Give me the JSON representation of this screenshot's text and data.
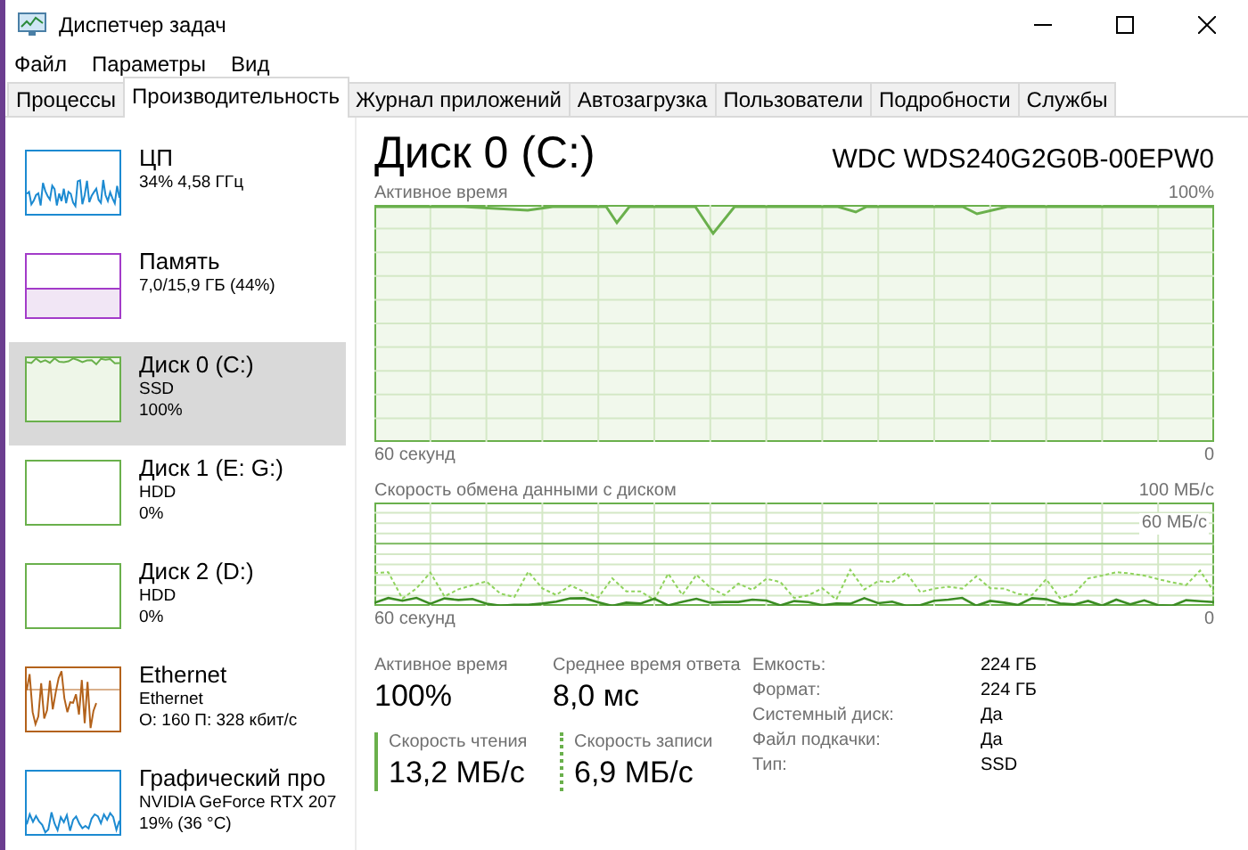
{
  "window": {
    "title": "Диспетчер задач"
  },
  "menu": [
    "Файл",
    "Параметры",
    "Вид"
  ],
  "tabs": [
    {
      "label": "Процессы",
      "selected": false
    },
    {
      "label": "Производительность",
      "selected": true
    },
    {
      "label": "Журнал приложений",
      "selected": false
    },
    {
      "label": "Автозагрузка",
      "selected": false
    },
    {
      "label": "Пользователи",
      "selected": false
    },
    {
      "label": "Подробности",
      "selected": false
    },
    {
      "label": "Службы",
      "selected": false
    }
  ],
  "sidebar": {
    "items": [
      {
        "kind": "cpu",
        "color": "#1c8ad1",
        "title": "ЦП",
        "lines": [
          "34% 4,58 ГГц"
        ],
        "selected": false
      },
      {
        "kind": "memory",
        "color": "#a33bc9",
        "title": "Память",
        "lines": [
          "7,0/15,9 ГБ (44%)"
        ],
        "selected": false
      },
      {
        "kind": "disk-busy",
        "color": "#6ab04c",
        "title": "Диск 0 (C:)",
        "lines": [
          "SSD",
          "100%"
        ],
        "selected": true
      },
      {
        "kind": "disk-idle",
        "color": "#6ab04c",
        "title": "Диск 1 (E: G:)",
        "lines": [
          "HDD",
          "0%"
        ],
        "selected": false
      },
      {
        "kind": "disk-idle",
        "color": "#6ab04c",
        "title": "Диск 2 (D:)",
        "lines": [
          "HDD",
          "0%"
        ],
        "selected": false
      },
      {
        "kind": "network",
        "color": "#b3621b",
        "title": "Ethernet",
        "lines": [
          "Ethernet",
          "О: 160 П: 328 кбит/с"
        ],
        "selected": false
      },
      {
        "kind": "gpu",
        "color": "#1c8ad1",
        "title": "Графический про",
        "lines": [
          "NVIDIA GeForce RTX 207",
          "19% (36 °C)"
        ],
        "selected": false
      }
    ]
  },
  "detail": {
    "title": "Диск 0 (C:)",
    "model": "WDC WDS240G2G0B-00EPW0",
    "active_graph": {
      "label": "Активное время",
      "max": "100%",
      "time": "60 секунд",
      "min": "0"
    },
    "transfer_graph": {
      "label": "Скорость обмена данными с диском",
      "max": "100 МБ/с",
      "mark": "60 МБ/с",
      "time": "60 секунд",
      "min": "0"
    },
    "stats": [
      {
        "label": "Активное время",
        "value": "100%"
      },
      {
        "label": "Среднее время ответа",
        "value": "8,0 мс"
      }
    ],
    "rates": [
      {
        "kind": "read",
        "label": "Скорость чтения",
        "value": "13,2 МБ/с"
      },
      {
        "kind": "write",
        "label": "Скорость записи",
        "value": "6,9 МБ/с"
      }
    ],
    "properties": [
      {
        "key": "Емкость:",
        "value": "224 ГБ"
      },
      {
        "key": "Формат:",
        "value": "224 ГБ"
      },
      {
        "key": "Системный диск:",
        "value": "Да"
      },
      {
        "key": "Файл подкачки:",
        "value": "Да"
      },
      {
        "key": "Тип:",
        "value": "SSD"
      }
    ]
  }
}
